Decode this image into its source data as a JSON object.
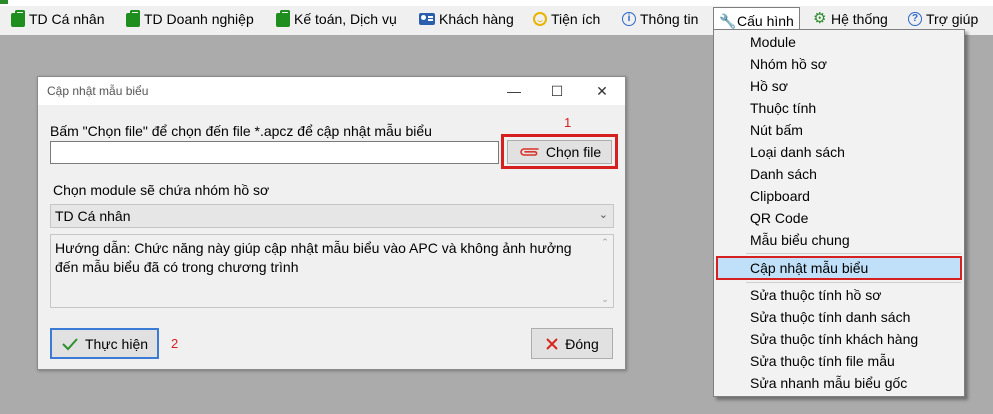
{
  "menubar": {
    "items": [
      {
        "label": "TD Cá nhân",
        "icon": "briefcase-icon"
      },
      {
        "label": "TD Doanh nghiệp",
        "icon": "briefcase-icon"
      },
      {
        "label": "Kế toán, Dịch vụ",
        "icon": "briefcase-icon"
      },
      {
        "label": "Khách hàng",
        "icon": "contact-card-icon"
      },
      {
        "label": "Tiện ích",
        "icon": "smiley-icon"
      },
      {
        "label": "Thông tin",
        "icon": "info-icon"
      },
      {
        "label": "Cấu hình",
        "icon": "wrench-icon"
      },
      {
        "label": "Hệ thống",
        "icon": "gear-icon"
      },
      {
        "label": "Trợ giúp",
        "icon": "help-icon"
      }
    ]
  },
  "config_menu": {
    "items": [
      "Module",
      "Nhóm hồ sơ",
      "Hồ sơ",
      "Thuộc tính",
      "Nút bấm",
      "Loại danh sách",
      "Danh sách",
      "Clipboard",
      "QR Code",
      "Mẫu biểu chung"
    ],
    "highlighted": "Cập nhật mẫu biểu",
    "items_after": [
      "Sửa thuộc tính hồ sơ",
      "Sửa thuộc tính danh sách",
      "Sửa thuộc tính khách hàng",
      "Sửa thuộc tính file mẫu",
      "Sửa nhanh mẫu biểu gốc"
    ]
  },
  "dialog": {
    "title": "Cập nhật mẫu biểu",
    "file_label": "Bấm \"Chọn file\" để chọn đến file *.apcz để cập nhật mẫu biểu",
    "file_value": "",
    "choose_file_button": "Chọn file",
    "step1": "1",
    "module_label": "Chọn module sẽ chứa nhóm hồ sơ",
    "module_selected": "TD Cá nhân",
    "help_text": "Hướng dẫn: Chức năng này giúp cập nhật mẫu  biểu vào APC và không ảnh hưởng đến mẫu biểu đã có trong chương trình",
    "execute_button": "Thực hiện",
    "step2": "2",
    "close_button": "Đóng"
  },
  "colors": {
    "highlight_border": "#d61f1f",
    "highlight_fill": "#bfe0f8",
    "primary_border": "#3a7bd5",
    "menu_icon_green": "#1e8e1e"
  }
}
